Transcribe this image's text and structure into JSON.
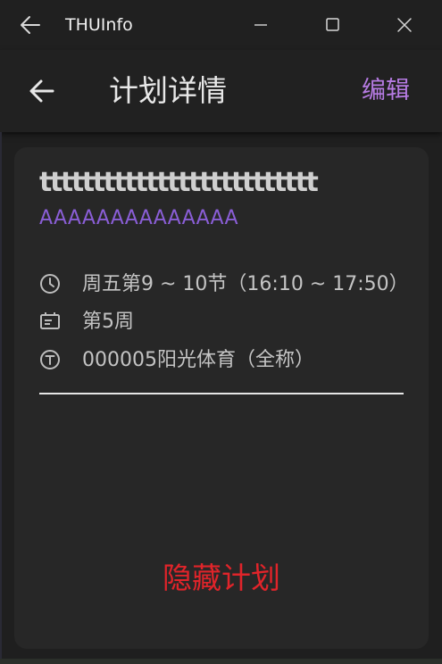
{
  "window": {
    "title": "THUInfo",
    "back_icon": "arrow-left-icon",
    "minimize_icon": "minimize-icon",
    "maximize_icon": "maximize-icon",
    "close_icon": "close-icon"
  },
  "header": {
    "back_icon": "arrow-left-icon",
    "title": "计划详情",
    "edit_label": "编辑"
  },
  "plan": {
    "title": "tttttttttttttttttttttttttt",
    "subtitle": "AAAAAAAAAAAAAA",
    "time": {
      "icon": "clock-icon",
      "text": "周五第9 ~ 10节（16:10 ~ 17:50）"
    },
    "week": {
      "icon": "calendar-week-icon",
      "text": "第5周"
    },
    "place": {
      "icon": "location-t-icon",
      "text": "000005阳光体育（全称）"
    },
    "hide_label": "隐藏计划"
  },
  "colors": {
    "accent_purple": "#b67be3",
    "subtitle_purple": "#8a5ed6",
    "danger_red": "#e0242a",
    "background": "#1f1f1f",
    "card": "#272727"
  }
}
